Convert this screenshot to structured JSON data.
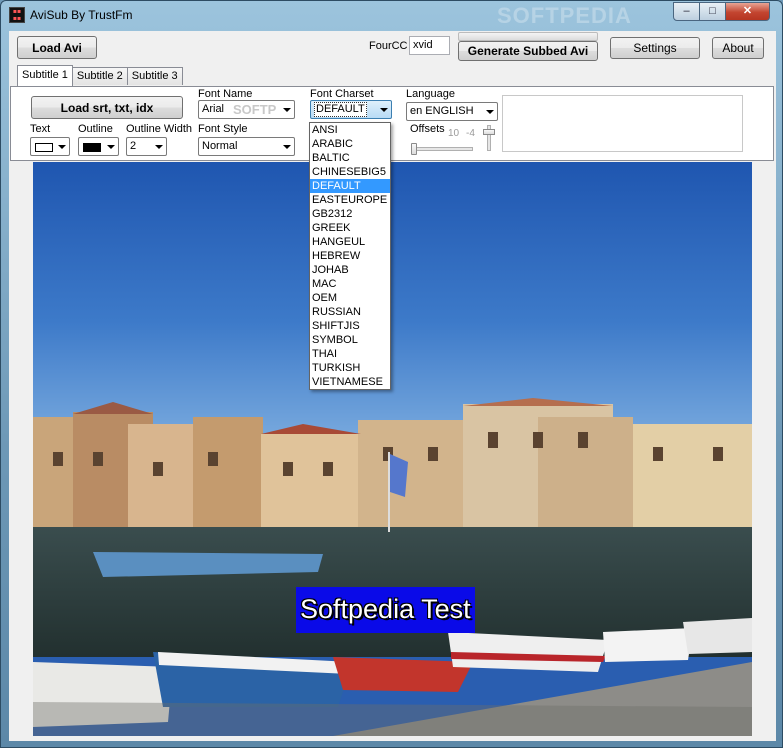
{
  "window": {
    "title": "AviSub By TrustFm",
    "watermark": "SOFTPEDIA"
  },
  "toolbar": {
    "load_avi": "Load Avi",
    "fourcc_label": "FourCC",
    "fourcc_value": "xvid",
    "generate": "Generate Subbed Avi",
    "settings": "Settings",
    "about": "About"
  },
  "tabs": [
    "Subtitle 1",
    "Subtitle 2",
    "Subtitle 3"
  ],
  "panel": {
    "load_subs": "Load srt, txt, idx",
    "font_name_label": "Font Name",
    "font_name_value": "Arial",
    "font_charset_label": "Font Charset",
    "font_charset_value": "DEFAULT",
    "language_label": "Language",
    "language_value": "en ENGLISH",
    "text_label": "Text",
    "text_color": "#ffffff",
    "outline_label": "Outline",
    "outline_color": "#000000",
    "outline_width_label": "Outline Width",
    "outline_width_value": "2",
    "font_style_label": "Font Style",
    "font_style_value": "Normal",
    "offsets_label": "Offsets",
    "offset_x_value": "10",
    "offset_y_value": "-4",
    "font_name_watermark": "SOFTP"
  },
  "charset_options": [
    "ANSI",
    "ARABIC",
    "BALTIC",
    "CHINESEBIG5",
    "DEFAULT",
    "EASTEUROPE",
    "GB2312",
    "GREEK",
    "HANGEUL",
    "HEBREW",
    "JOHAB",
    "MAC",
    "OEM",
    "RUSSIAN",
    "SHIFTJIS",
    "SYMBOL",
    "THAI",
    "TURKISH",
    "VIETNAMESE"
  ],
  "charset_selected_index": 4,
  "preview": {
    "subtitle_text": "Softpedia Test",
    "subtitle_bg": "#0a0ae8"
  }
}
